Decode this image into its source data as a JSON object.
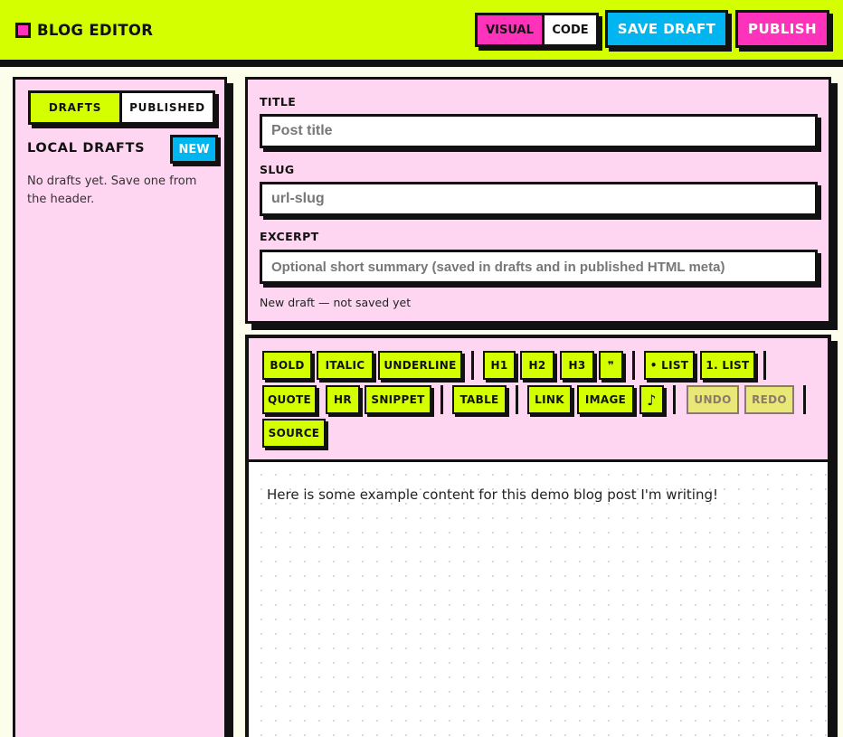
{
  "header": {
    "title": "BLOG EDITOR",
    "mode_visual": "VISUAL",
    "mode_code": "CODE",
    "save_label": "SAVE DRAFT",
    "publish_label": "PUBLISH"
  },
  "sidebar": {
    "tab_drafts": "DRAFTS",
    "tab_published": "PUBLISHED",
    "section_title": "LOCAL DRAFTS",
    "new_label": "NEW",
    "empty_text": "No drafts yet. Save one from the header."
  },
  "meta": {
    "title_label": "TITLE",
    "title_placeholder": "Post title",
    "slug_label": "SLUG",
    "slug_placeholder": "url-slug",
    "excerpt_label": "EXCERPT",
    "excerpt_placeholder": "Optional short summary (saved in drafts and in published HTML meta)",
    "status": "New draft — not saved yet"
  },
  "toolbar": {
    "bold": "BOLD",
    "italic": "ITALIC",
    "underline": "UNDERLINE",
    "h1": "H1",
    "h2": "H2",
    "h3": "H3",
    "blockquote_glyph": "❞",
    "bullet_list": "• LIST",
    "numbered_list": "1. LIST",
    "quote": "QUOTE",
    "hr": "HR",
    "snippet": "SNIPPET",
    "table": "TABLE",
    "link": "LINK",
    "image": "IMAGE",
    "audio_glyph": "♪",
    "undo": "UNDO",
    "redo": "REDO",
    "source": "SOURCE"
  },
  "editor": {
    "content": "Here is some example content for this demo blog post I'm writing!"
  },
  "colors": {
    "accent_lime": "#d4ff00",
    "accent_pink": "#ff33bb",
    "accent_blue": "#00b5f0",
    "panel_pink": "#ffd6f2"
  }
}
